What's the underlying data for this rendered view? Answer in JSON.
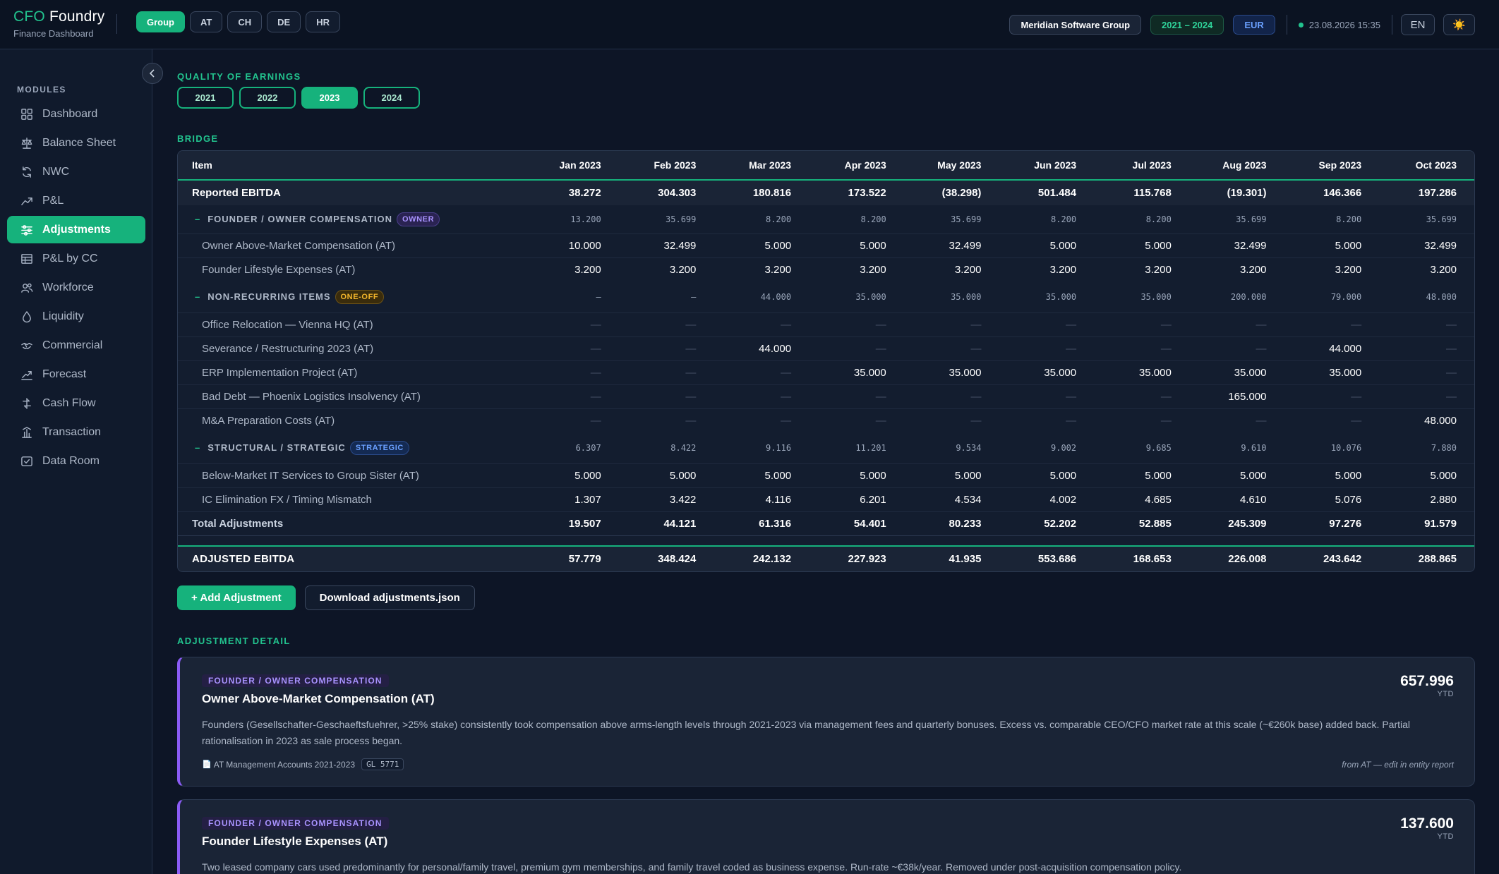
{
  "brand": {
    "prefix": "CFO",
    "name": "Foundry",
    "subtitle": "Finance Dashboard"
  },
  "entity_tabs": [
    {
      "label": "Group",
      "active": true
    },
    {
      "label": "AT",
      "active": false
    },
    {
      "label": "CH",
      "active": false
    },
    {
      "label": "DE",
      "active": false
    },
    {
      "label": "HR",
      "active": false
    }
  ],
  "header": {
    "company": "Meridian Software Group",
    "period": "2021 – 2024",
    "currency": "EUR",
    "timestamp": "23.08.2026 15:35",
    "language": "EN",
    "theme_icon": "☀️"
  },
  "sidebar": {
    "section_label": "MODULES",
    "items": [
      {
        "label": "Dashboard",
        "icon": "grid-icon"
      },
      {
        "label": "Balance Sheet",
        "icon": "scale-icon"
      },
      {
        "label": "NWC",
        "icon": "cycle-icon"
      },
      {
        "label": "P&L",
        "icon": "trend-icon"
      },
      {
        "label": "Adjustments",
        "icon": "sliders-icon",
        "active": true
      },
      {
        "label": "P&L by CC",
        "icon": "table-icon"
      },
      {
        "label": "Workforce",
        "icon": "users-icon"
      },
      {
        "label": "Liquidity",
        "icon": "droplet-icon"
      },
      {
        "label": "Commercial",
        "icon": "handshake-icon"
      },
      {
        "label": "Forecast",
        "icon": "forecast-icon"
      },
      {
        "label": "Cash Flow",
        "icon": "cashflow-icon"
      },
      {
        "label": "Transaction",
        "icon": "transaction-icon"
      },
      {
        "label": "Data Room",
        "icon": "dataroom-icon"
      }
    ]
  },
  "qoe": {
    "section_label": "QUALITY OF EARNINGS",
    "years": [
      {
        "label": "2021",
        "active": false
      },
      {
        "label": "2022",
        "active": false
      },
      {
        "label": "2023",
        "active": true
      },
      {
        "label": "2024",
        "active": false
      }
    ]
  },
  "bridge": {
    "section_label": "BRIDGE",
    "columns": [
      "Item",
      "Jan 2023",
      "Feb 2023",
      "Mar 2023",
      "Apr 2023",
      "May 2023",
      "Jun 2023",
      "Jul 2023",
      "Aug 2023",
      "Sep 2023",
      "Oct 2023"
    ],
    "reported": {
      "label": "Reported EBITDA",
      "values": [
        "38.272",
        "304.303",
        "180.816",
        "173.522",
        "(38.298)",
        "501.484",
        "115.768",
        "(19.301)",
        "146.366",
        "197.286"
      ]
    },
    "categories": [
      {
        "label": "FOUNDER / OWNER COMPENSATION",
        "badge": "OWNER",
        "badge_class": "owner",
        "values": [
          "13.200",
          "35.699",
          "8.200",
          "8.200",
          "35.699",
          "8.200",
          "8.200",
          "35.699",
          "8.200",
          "35.699"
        ],
        "items": [
          {
            "label": "Owner Above-Market Compensation (AT)",
            "values": [
              "10.000",
              "32.499",
              "5.000",
              "5.000",
              "32.499",
              "5.000",
              "5.000",
              "32.499",
              "5.000",
              "32.499"
            ]
          },
          {
            "label": "Founder Lifestyle Expenses (AT)",
            "values": [
              "3.200",
              "3.200",
              "3.200",
              "3.200",
              "3.200",
              "3.200",
              "3.200",
              "3.200",
              "3.200",
              "3.200"
            ]
          }
        ]
      },
      {
        "label": "NON-RECURRING ITEMS",
        "badge": "ONE-OFF",
        "badge_class": "oneoff",
        "values": [
          "—",
          "—",
          "44.000",
          "35.000",
          "35.000",
          "35.000",
          "35.000",
          "200.000",
          "79.000",
          "48.000"
        ],
        "items": [
          {
            "label": "Office Relocation — Vienna HQ (AT)",
            "values": [
              "—",
              "—",
              "—",
              "—",
              "—",
              "—",
              "—",
              "—",
              "—",
              "—"
            ]
          },
          {
            "label": "Severance / Restructuring 2023 (AT)",
            "values": [
              "—",
              "—",
              "44.000",
              "—",
              "—",
              "—",
              "—",
              "—",
              "44.000",
              "—"
            ]
          },
          {
            "label": "ERP Implementation Project (AT)",
            "values": [
              "—",
              "—",
              "—",
              "35.000",
              "35.000",
              "35.000",
              "35.000",
              "35.000",
              "35.000",
              "—"
            ]
          },
          {
            "label": "Bad Debt — Phoenix Logistics Insolvency (AT)",
            "values": [
              "—",
              "—",
              "—",
              "—",
              "—",
              "—",
              "—",
              "165.000",
              "—",
              "—"
            ]
          },
          {
            "label": "M&A Preparation Costs (AT)",
            "values": [
              "—",
              "—",
              "—",
              "—",
              "—",
              "—",
              "—",
              "—",
              "—",
              "48.000"
            ]
          }
        ]
      },
      {
        "label": "STRUCTURAL / STRATEGIC",
        "badge": "STRATEGIC",
        "badge_class": "strategic",
        "values": [
          "6.307",
          "8.422",
          "9.116",
          "11.201",
          "9.534",
          "9.002",
          "9.685",
          "9.610",
          "10.076",
          "7.880"
        ],
        "items": [
          {
            "label": "Below-Market IT Services to Group Sister (AT)",
            "values": [
              "5.000",
              "5.000",
              "5.000",
              "5.000",
              "5.000",
              "5.000",
              "5.000",
              "5.000",
              "5.000",
              "5.000"
            ]
          },
          {
            "label": "IC Elimination FX / Timing Mismatch",
            "values": [
              "1.307",
              "3.422",
              "4.116",
              "6.201",
              "4.534",
              "4.002",
              "4.685",
              "4.610",
              "5.076",
              "2.880"
            ]
          }
        ]
      }
    ],
    "total": {
      "label": "Total Adjustments",
      "values": [
        "19.507",
        "44.121",
        "61.316",
        "54.401",
        "80.233",
        "52.202",
        "52.885",
        "245.309",
        "97.276",
        "91.579"
      ]
    },
    "adjusted": {
      "label": "ADJUSTED EBITDA",
      "values": [
        "57.779",
        "348.424",
        "242.132",
        "227.923",
        "41.935",
        "553.686",
        "168.653",
        "226.008",
        "243.642",
        "288.865"
      ]
    }
  },
  "actions": {
    "add": "+ Add Adjustment",
    "download": "Download adjustments.json"
  },
  "detail": {
    "section_label": "ADJUSTMENT DETAIL",
    "cards": [
      {
        "category": "FOUNDER / OWNER COMPENSATION",
        "title": "Owner Above-Market Compensation (AT)",
        "amount": "657.996",
        "amount_unit": "YTD",
        "body": "Founders (Gesellschafter-Geschaeftsfuehrer, >25% stake) consistently took compensation above arms-length levels through 2021-2023 via management fees and quarterly bonuses. Excess vs. comparable CEO/CFO market rate at this scale (~€260k base) added back. Partial rationalisation in 2023 as sale process began.",
        "source": "AT Management Accounts 2021-2023",
        "gl": "GL 5771",
        "note": "from AT — edit in entity report"
      },
      {
        "category": "FOUNDER / OWNER COMPENSATION",
        "title": "Founder Lifestyle Expenses (AT)",
        "amount": "137.600",
        "amount_unit": "YTD",
        "body": "Two leased company cars used predominantly for personal/family travel, premium gym memberships, and family travel coded as business expense. Run-rate ~€38k/year. Removed under post-acquisition compensation policy."
      }
    ]
  }
}
